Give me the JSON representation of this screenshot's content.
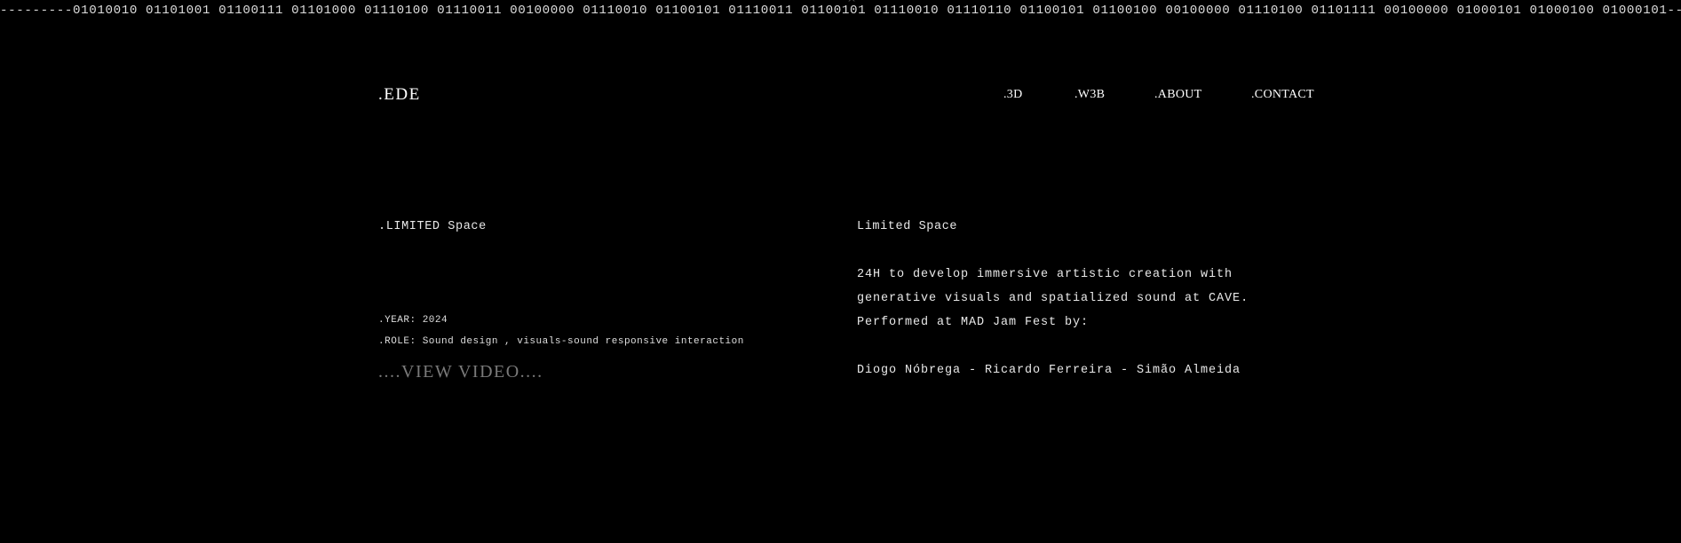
{
  "ticker": {
    "text": "---------01010010 01101001 01100111 01101000 01110100 01110011 00100000 01110010 01100101 01110011 01100101 01110010 01110110 01100101 01100100 00100000 01110100 01101111 00100000 01000101 01000100 01000101-------"
  },
  "header": {
    "logo": ".EDE",
    "nav": [
      {
        "label": ".3D"
      },
      {
        "label": ".W3B"
      },
      {
        "label": ".ABOUT"
      },
      {
        "label": ".CONTACT"
      }
    ]
  },
  "project": {
    "title": ".LIMITED Space",
    "year": ".YEAR: 2024",
    "role": ".ROLE: Sound design , visuals-sound responsive interaction",
    "view_video": "....VIEW VIDEO...."
  },
  "details": {
    "title": "Limited Space",
    "description_lines": [
      "24H to develop immersive artistic creation with",
      "generative visuals and spatialized sound at CAVE.",
      "Performed at MAD Jam Fest by:"
    ],
    "credits": "Diogo Nóbrega - Ricardo Ferreira - Simão Almeida"
  },
  "icons": {
    "scroll_up": "caret-up-icon"
  }
}
